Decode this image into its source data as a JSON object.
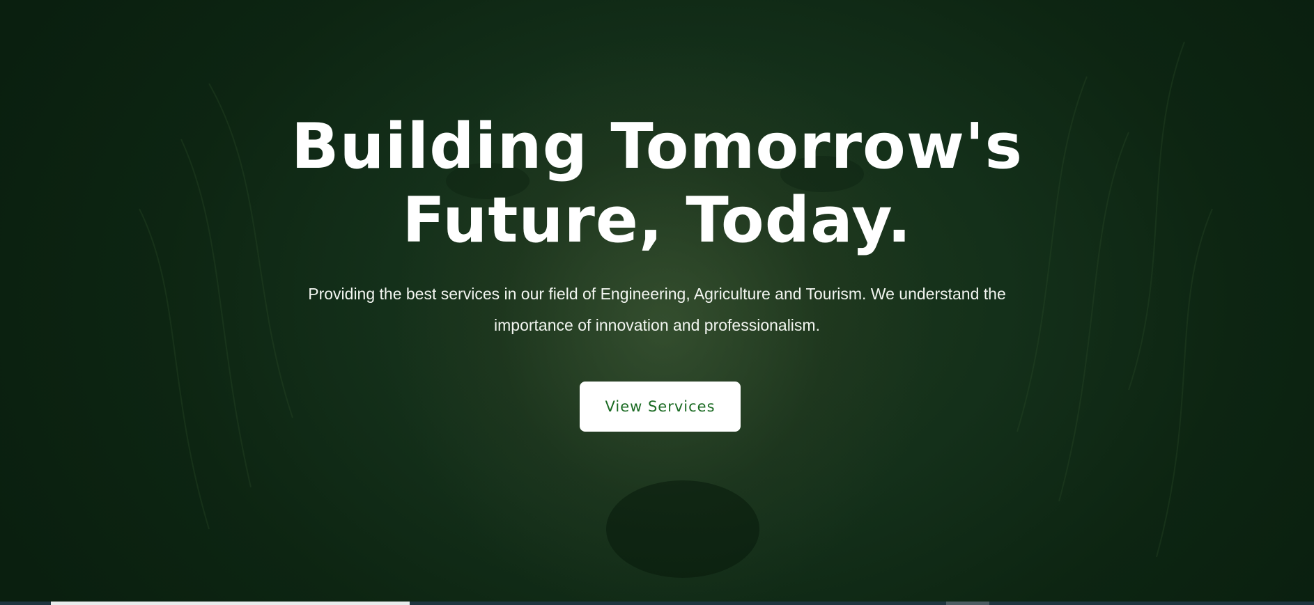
{
  "hero": {
    "headline_line1": "Building Tomorrow's",
    "headline_line2": "Future, Today.",
    "subtext": "Providing the best services in our field of Engineering, Agriculture and Tourism. We understand the importance of innovation and professionalism.",
    "cta_label": "View Services",
    "background_image": "lion-face",
    "overlay_color": "#0d2a12",
    "cta_text_color": "#1a6a22"
  }
}
